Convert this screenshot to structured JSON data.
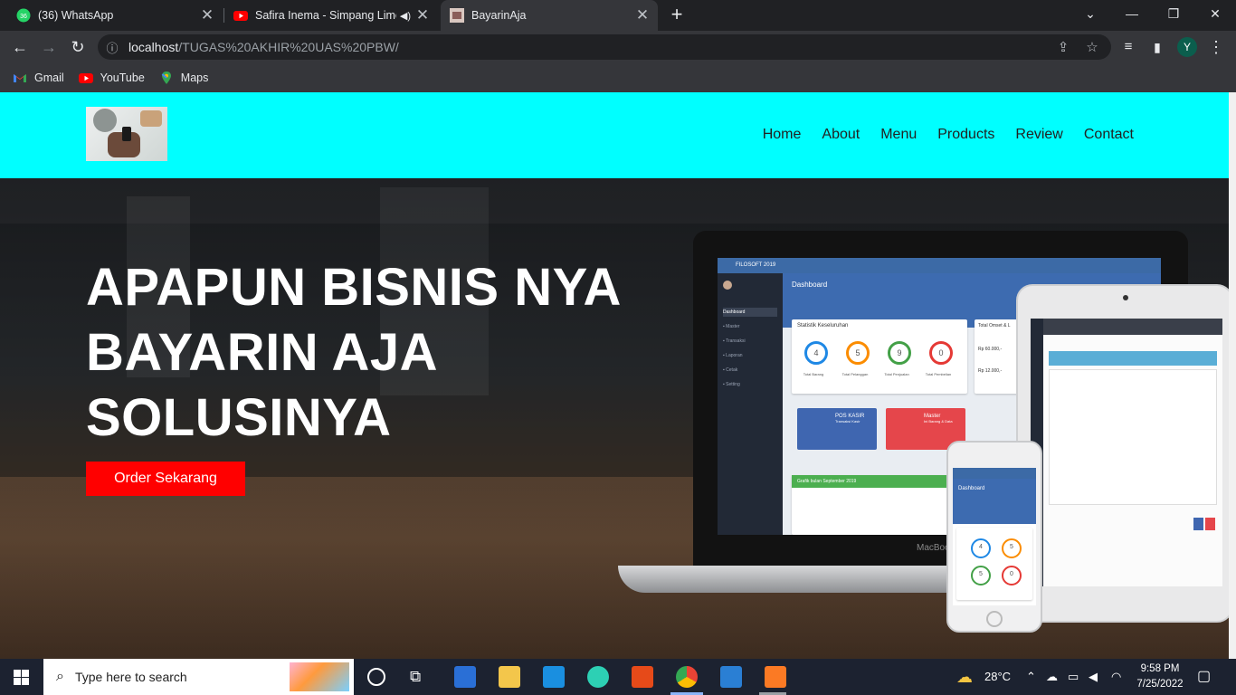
{
  "browser": {
    "tabs": [
      {
        "label": "(36) WhatsApp",
        "icon": "whatsapp-icon",
        "active": false
      },
      {
        "label": "Safira Inema - Simpang Limo",
        "icon": "youtube-icon",
        "active": false,
        "audio": true
      },
      {
        "label": "BayarinAja",
        "icon": "site-icon",
        "active": true
      }
    ],
    "url_host": "localhost",
    "url_path": "/TUGAS%20AKHIR%20UAS%20PBW/",
    "profile_initial": "Y",
    "bookmarks": [
      {
        "label": "Gmail",
        "icon": "gmail-icon"
      },
      {
        "label": "YouTube",
        "icon": "youtube-icon"
      },
      {
        "label": "Maps",
        "icon": "maps-icon"
      }
    ]
  },
  "site": {
    "nav": [
      "Home",
      "About",
      "Menu",
      "Products",
      "Review",
      "Contact"
    ],
    "headline_lines": [
      "APAPUN BISNIS NYA",
      "BAYARIN AJA",
      "SOLUSINYA"
    ],
    "cta_label": "Order Sekarang",
    "mockup": {
      "brand": "FILOSOFT 2019",
      "dashboard_title": "Dashboard",
      "stats_title": "Statistik Keseluruhan",
      "stats": [
        {
          "value": "4",
          "label": "Total Barang",
          "color": "#1e88e5"
        },
        {
          "value": "5",
          "label": "Total Pelanggan",
          "color": "#fb8c00"
        },
        {
          "value": "9",
          "label": "Total Penjualan",
          "color": "#43a047"
        },
        {
          "value": "0",
          "label": "Total Pembelian",
          "color": "#e53935"
        }
      ],
      "omset_title": "Total Omset & L",
      "omset_value": "Rp 60.000,-",
      "laba_value": "Rp 12.000,-",
      "tiles": [
        {
          "title": "POS KASIR",
          "sub": "Transaksi Kasir",
          "color": "#3f66b0"
        },
        {
          "title": "Master",
          "sub": "Ini Barang & Data",
          "color": "#e5464b"
        }
      ],
      "chart_title": "Grafik bulan September 2019",
      "laptop_label": "MacBook",
      "phone_stats": [
        "4",
        "5",
        "5",
        "0"
      ]
    }
  },
  "taskbar": {
    "search_placeholder": "Type here to search",
    "weather": "28°C",
    "time": "9:58 PM",
    "date": "7/25/2022"
  }
}
